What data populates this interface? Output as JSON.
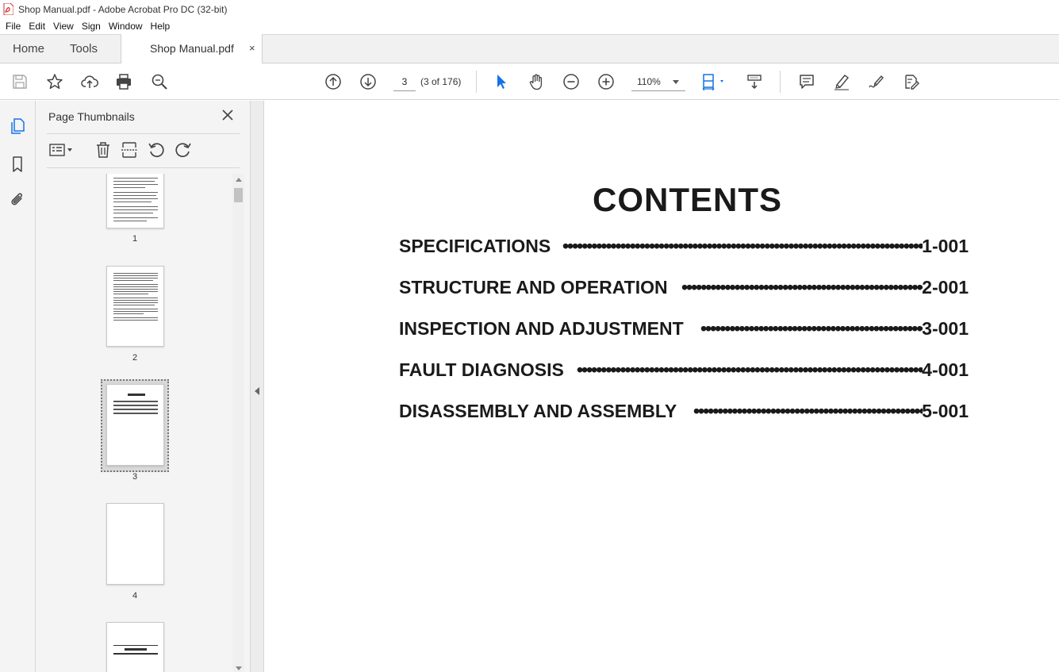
{
  "window": {
    "title": "Shop Manual.pdf - Adobe Acrobat Pro DC (32-bit)"
  },
  "menu": [
    "File",
    "Edit",
    "View",
    "Sign",
    "Window",
    "Help"
  ],
  "tabs": {
    "home": "Home",
    "tools": "Tools",
    "document": "Shop Manual.pdf",
    "close": "×"
  },
  "toolbar": {
    "page_value": "3",
    "page_count": "(3 of 176)",
    "zoom": "110%"
  },
  "panel": {
    "title": "Page Thumbnails",
    "thumbnails": [
      {
        "label": "1"
      },
      {
        "label": "2"
      },
      {
        "label": "3",
        "selected": true
      },
      {
        "label": "4"
      },
      {
        "label": ""
      }
    ]
  },
  "document": {
    "heading": "CONTENTS",
    "toc": [
      {
        "title": "SPECIFICATIONS",
        "page": "1-001"
      },
      {
        "title": "STRUCTURE AND OPERATION",
        "page": "2-001"
      },
      {
        "title": "INSPECTION AND ADJUSTMENT",
        "page": "3-001"
      },
      {
        "title": "FAULT DIAGNOSIS",
        "page": "4-001"
      },
      {
        "title": "DISASSEMBLY AND ASSEMBLY",
        "page": "5-001"
      }
    ]
  },
  "colors": {
    "accent": "#1473e6",
    "pdf_red": "#d7261e",
    "panel_bg": "#f4f4f4"
  }
}
